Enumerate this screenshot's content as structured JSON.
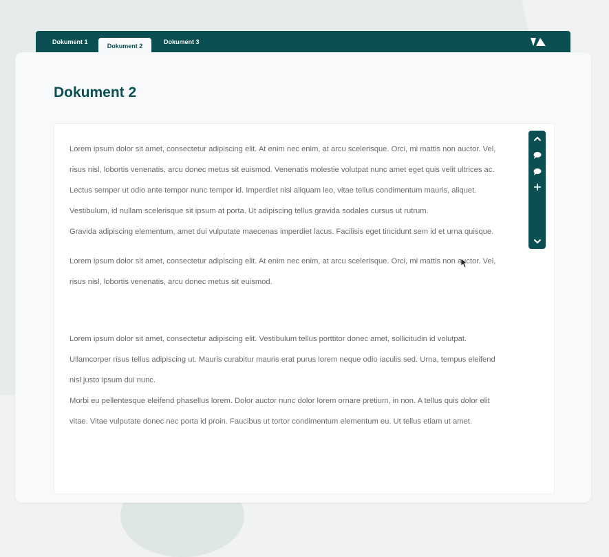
{
  "tabs": [
    {
      "label": "Dokument 1",
      "active": false
    },
    {
      "label": "Dokument 2",
      "active": true
    },
    {
      "label": "Dokument 3",
      "active": false
    }
  ],
  "document": {
    "title": "Dokument 2",
    "paragraphs": [
      {
        "lines": [
          "Lorem ipsum dolor sit amet, consectetur adipiscing elit. At enim nec enim, at arcu scelerisque. Orci, mi mattis non auctor. Vel,",
          "risus nisl, lobortis venenatis, arcu donec metus sit euismod. Venenatis molestie volutpat nunc amet eget quis velit ultrices ac.",
          "Lectus semper ut odio ante tempor nunc tempor id. Imperdiet nisi aliquam leo, vitae tellus condimentum mauris, aliquet.",
          "Vestibulum, id nullam scelerisque sit ipsum at porta. Ut adipiscing tellus gravida sodales cursus ut rutrum.",
          "Gravida adipiscing elementum, amet dui vulputate maecenas imperdiet lacus. Facilisis eget tincidunt sem id et urna quisque."
        ]
      },
      {
        "lines": [
          "Lorem ipsum dolor sit amet, consectetur adipiscing elit. At enim nec enim, at arcu scelerisque. Orci, mi mattis non auctor. Vel,",
          "risus nisl, lobortis venenatis, arcu donec metus sit euismod."
        ]
      },
      {
        "lines": [
          "Lorem ipsum dolor sit amet, consectetur adipiscing elit. Vestibulum tellus porttitor donec amet, sollicitudin id volutpat.",
          "Ullamcorper risus tellus adipiscing ut. Mauris curabitur mauris erat purus lorem neque odio iaculis sed. Urna, tempus eleifend",
          "nisl justo ipsum dui nunc.",
          "Morbi eu pellentesque eleifend phasellus lorem. Dolor auctor nunc dolor lorem ornare pretium, in non. A tellus quis dolor elit",
          "vitae. Vitae vulputate donec nec porta id proin. Faucibus ut tortor condimentum elementum eu. Ut tellus etiam ut amet."
        ]
      }
    ]
  },
  "toolbar": {
    "icons": [
      "chevron-up-icon",
      "comment-icon",
      "comment-icon",
      "plus-icon",
      "chevron-down-icon"
    ]
  },
  "colors": {
    "accent": "#0b4f52",
    "text": "#6a6a6a",
    "panel": "#f7f9fa",
    "background": "#f1f2f2"
  }
}
